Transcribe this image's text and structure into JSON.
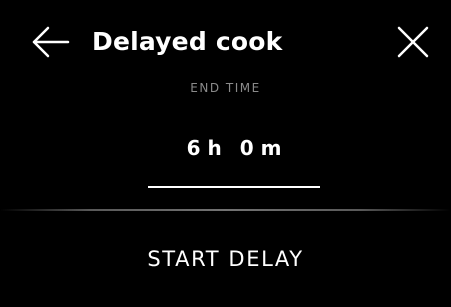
{
  "header": {
    "title": "Delayed cook",
    "back_icon": "arrow-left-icon",
    "close_icon": "close-icon"
  },
  "end_time": {
    "label": "END TIME",
    "hours": "6 h",
    "minutes": "0 m"
  },
  "actions": {
    "start_label": "START DELAY"
  },
  "colors": {
    "background": "#000000",
    "text": "#ffffff",
    "muted_text": "#8a8a8a"
  }
}
